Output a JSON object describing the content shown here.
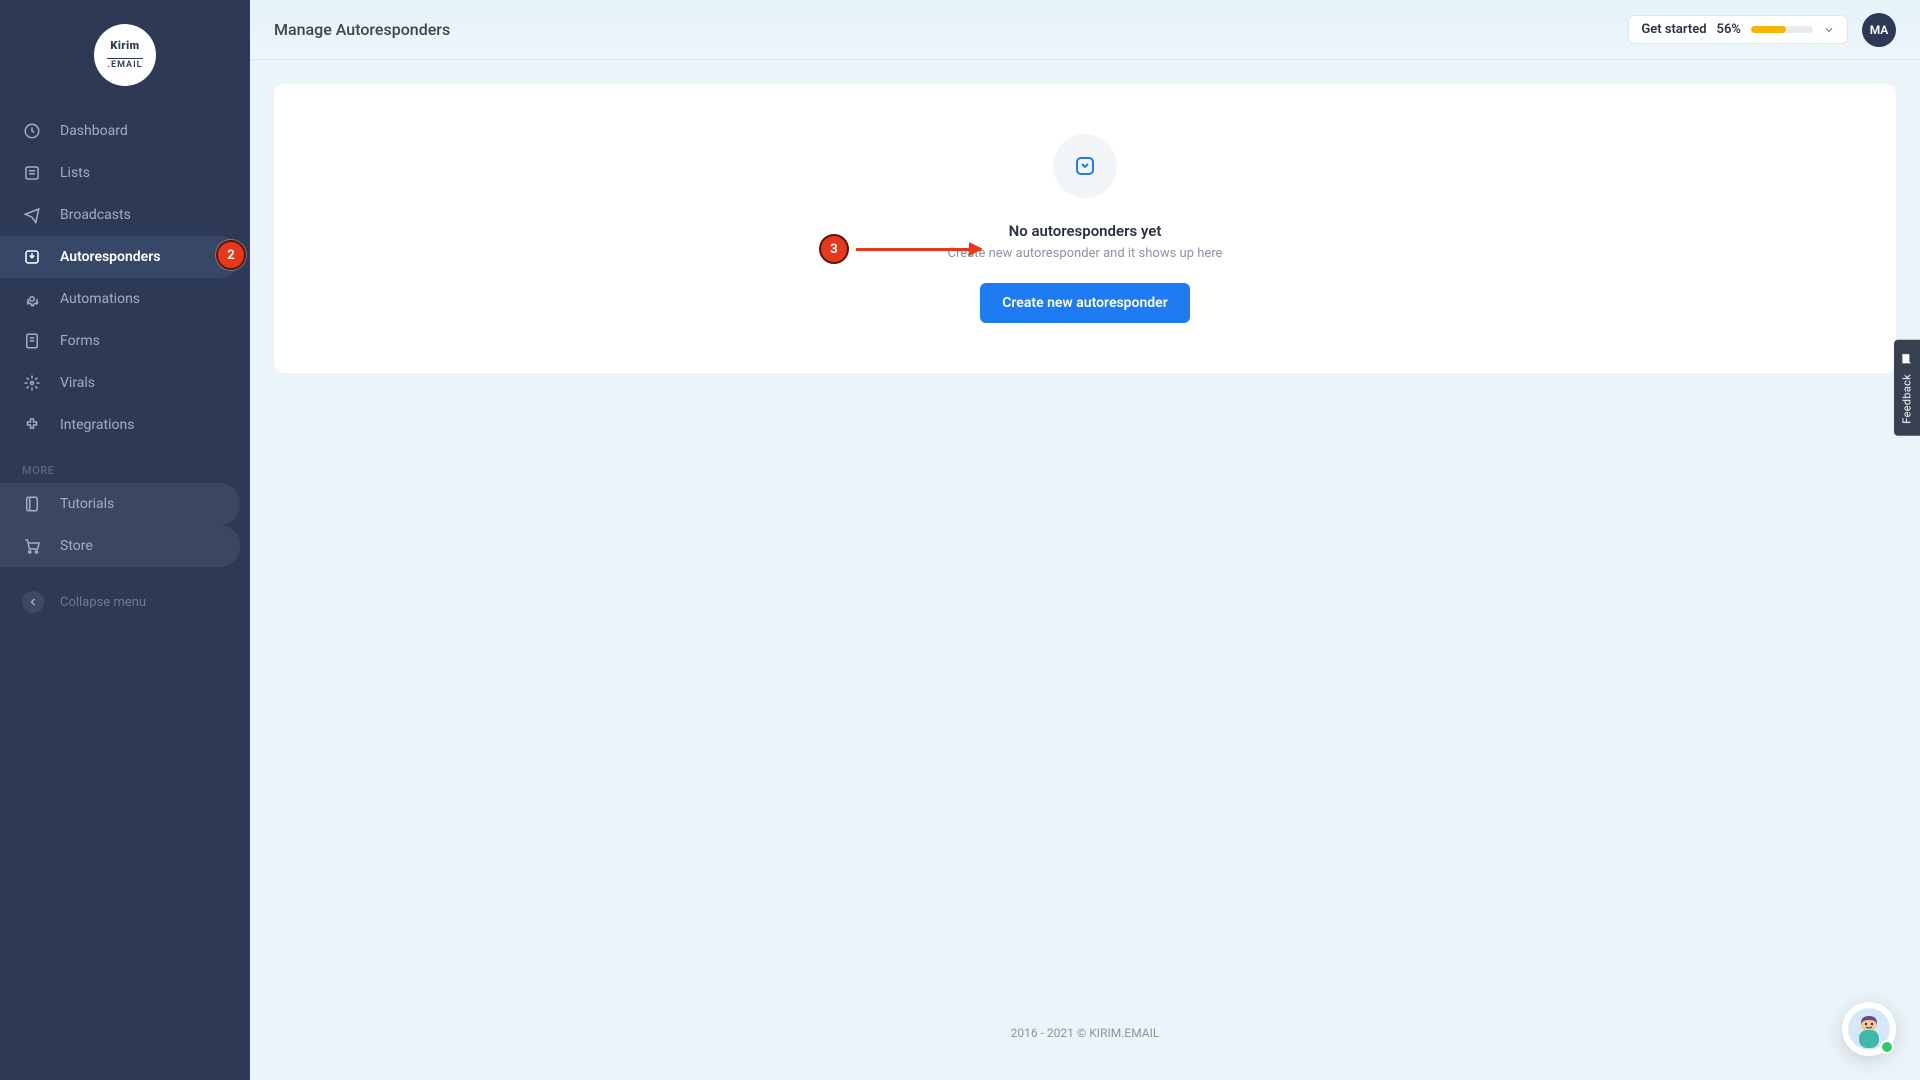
{
  "logo": {
    "line1": "Kirim",
    "line2": ".EMAIL"
  },
  "sidebar": {
    "items": [
      {
        "label": "Dashboard",
        "icon": "dashboard-icon"
      },
      {
        "label": "Lists",
        "icon": "lists-icon"
      },
      {
        "label": "Broadcasts",
        "icon": "broadcasts-icon"
      },
      {
        "label": "Autoresponders",
        "icon": "autoresponders-icon",
        "active": true
      },
      {
        "label": "Automations",
        "icon": "automations-icon"
      },
      {
        "label": "Forms",
        "icon": "forms-icon"
      },
      {
        "label": "Virals",
        "icon": "virals-icon"
      },
      {
        "label": "Integrations",
        "icon": "integrations-icon"
      }
    ],
    "more_label": "MORE",
    "more_items": [
      {
        "label": "Tutorials",
        "icon": "tutorials-icon"
      },
      {
        "label": "Store",
        "icon": "store-icon"
      }
    ],
    "collapse_label": "Collapse menu"
  },
  "header": {
    "title": "Manage Autoresponders",
    "get_started_label": "Get started",
    "get_started_pct": "56%",
    "progress_pct": 56,
    "avatar_initials": "MA"
  },
  "empty": {
    "title": "No autoresponders yet",
    "subtitle": "Create new autoresponder and it shows up here",
    "button": "Create new autoresponder"
  },
  "annotations": {
    "badge2": "2",
    "badge3": "3"
  },
  "feedback": {
    "label": "Feedback"
  },
  "footer": {
    "text": "2016 - 2021 © KIRIM.EMAIL"
  },
  "colors": {
    "accent": "#1e7bf2",
    "sidebar_bg": "#2d3955",
    "annotation": "#e8381b",
    "progress": "#f7b500"
  }
}
